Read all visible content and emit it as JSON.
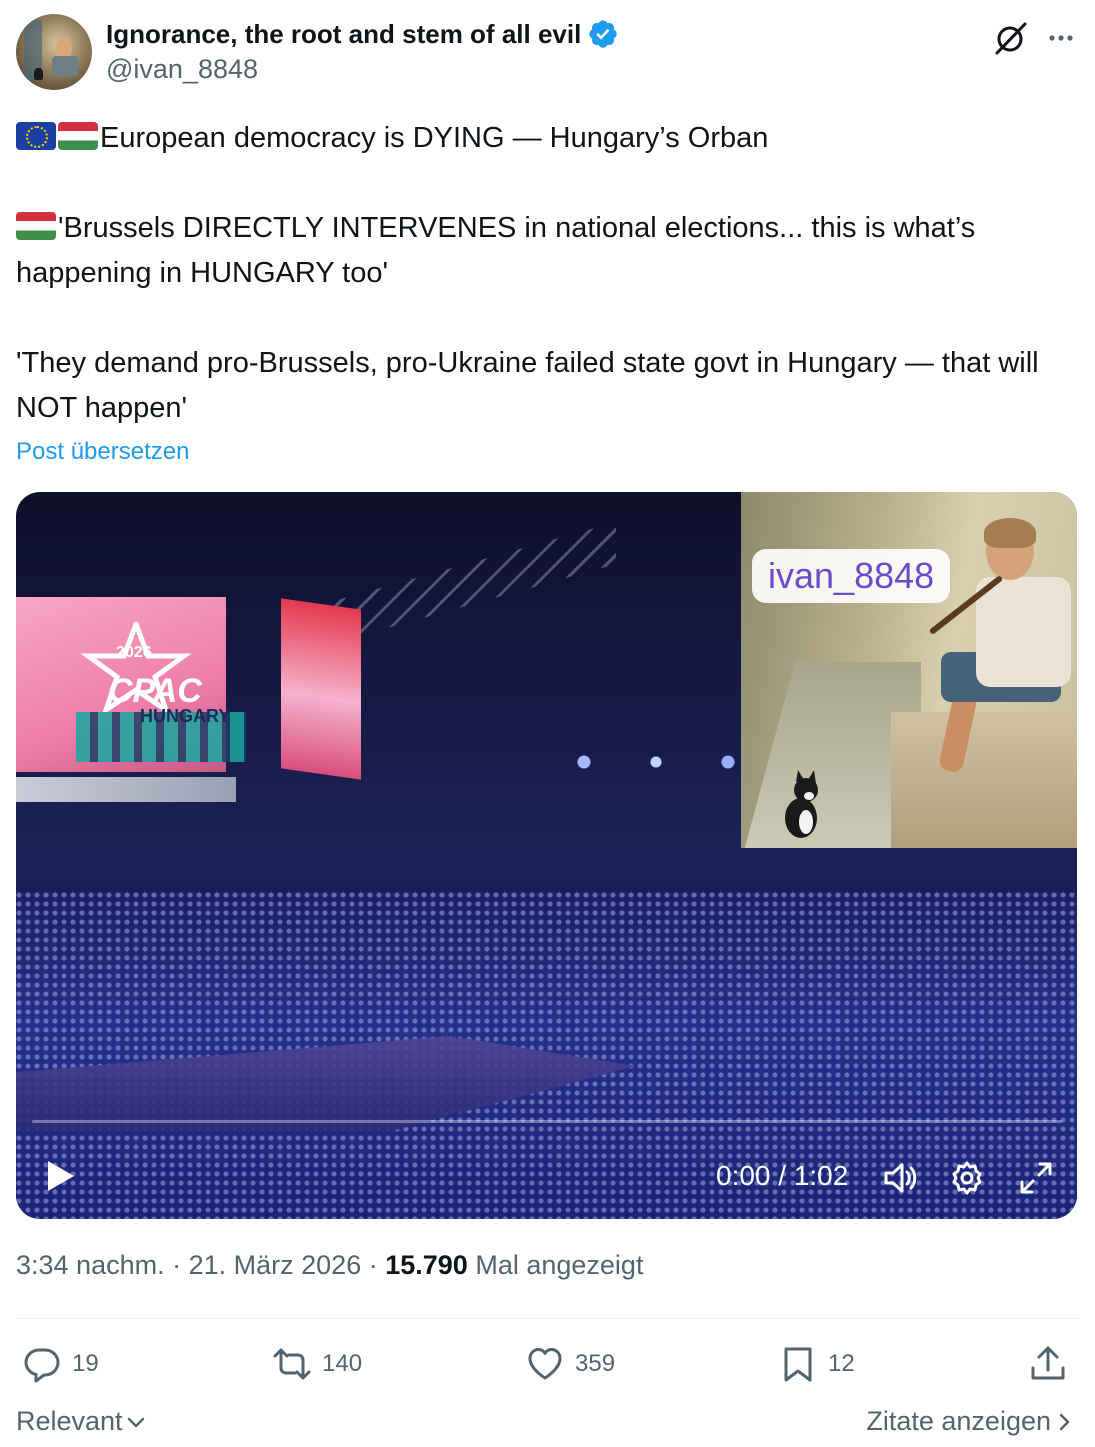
{
  "author": {
    "display_name": "Ignorance, the root and stem of all evil",
    "handle": "@ivan_8848",
    "verified": true,
    "verified_color": "#1d9bf0"
  },
  "tweet": {
    "line1": "European democracy is DYING — Hungary’s Orban",
    "line2": "'Brussels DIRECTLY INTERVENES in national elections... this is what’s happening in HUNGARY too'",
    "line3": "'They demand pro-Brussels, pro-Ukraine failed state govt in Hungary — that will NOT happen'",
    "line1_flags": [
      "eu-flag-icon",
      "hungary-flag-icon"
    ],
    "line2_flags": [
      "hungary-flag-icon"
    ],
    "translate_label": "Post übersetzen"
  },
  "video": {
    "watermark": "ivan_8848",
    "stage_screen_year": "2026",
    "stage_screen_brand": "CPAC",
    "stage_screen_country": "HUNGARY",
    "time_display": "0:00 / 1:02",
    "progress": 0.0
  },
  "meta": {
    "time": "3:34 nachm.",
    "date": "21. März 2026",
    "views": "15.790",
    "views_label": "Mal angezeigt"
  },
  "actions": {
    "replies": "19",
    "reposts": "140",
    "likes": "359",
    "bookmarks": "12"
  },
  "footer": {
    "sort_label": "Relevant",
    "quotes_label": "Zitate anzeigen"
  },
  "colors": {
    "text_primary": "#0f1419",
    "text_secondary": "#536471",
    "link": "#1d9bf0"
  }
}
